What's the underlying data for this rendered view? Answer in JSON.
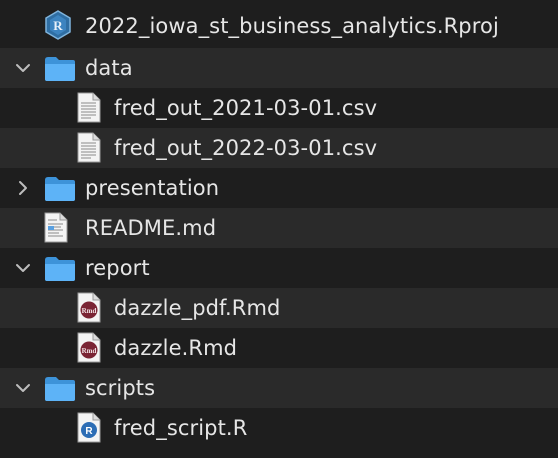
{
  "rows": [
    {
      "label": "2022_iowa_st_business_analytics.Rproj",
      "kind": "rproj",
      "depth": 0
    },
    {
      "label": "data",
      "kind": "folder",
      "depth": 0,
      "expanded": true
    },
    {
      "label": "fred_out_2021-03-01.csv",
      "kind": "csv",
      "depth": 1
    },
    {
      "label": "fred_out_2022-03-01.csv",
      "kind": "csv",
      "depth": 1
    },
    {
      "label": "presentation",
      "kind": "folder",
      "depth": 0,
      "expanded": false
    },
    {
      "label": "README.md",
      "kind": "md",
      "depth": 0
    },
    {
      "label": "report",
      "kind": "folder",
      "depth": 0,
      "expanded": true
    },
    {
      "label": "dazzle_pdf.Rmd",
      "kind": "rmd",
      "depth": 1
    },
    {
      "label": "dazzle.Rmd",
      "kind": "rmd",
      "depth": 1
    },
    {
      "label": "scripts",
      "kind": "folder",
      "depth": 0,
      "expanded": true
    },
    {
      "label": "fred_script.R",
      "kind": "r",
      "depth": 1
    }
  ],
  "colors": {
    "background": "#1e1e1e",
    "alt_row": "#2a2a2a",
    "folder": "#4aa9f5",
    "text": "#e6e6e6"
  }
}
